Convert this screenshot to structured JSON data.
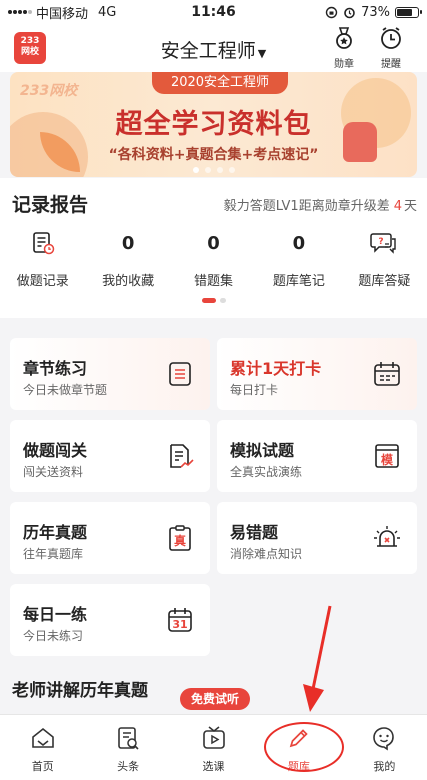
{
  "status": {
    "carrier": "中国移动",
    "network": "4G",
    "time": "11:46",
    "battery": "73%",
    "battery_level": 0.73
  },
  "header": {
    "logo_line1": "233",
    "logo_line2": "网校",
    "title": "安全工程师",
    "medal_label": "勋章",
    "remind_label": "提醒"
  },
  "banner": {
    "brand": "233网校",
    "pill": "2020安全工程师",
    "title": "超全学习资料包",
    "subtitle": "“各科资料+真题合集+考点速记”"
  },
  "record": {
    "title": "记录报告",
    "progress_prefix": "毅力答题LV1距离勋章升级差",
    "progress_num": "4",
    "progress_unit": "天",
    "items": [
      {
        "value": "",
        "icon": "record-doc-icon",
        "label": "做题记录"
      },
      {
        "value": "0",
        "label": "我的收藏"
      },
      {
        "value": "0",
        "label": "错题集"
      },
      {
        "value": "0",
        "label": "题库笔记"
      },
      {
        "value": "",
        "icon": "chat-question-icon",
        "label": "题库答疑"
      }
    ]
  },
  "cards": [
    {
      "title": "章节练习",
      "sub": "今日未做章节题",
      "icon": "list-doc-icon"
    },
    {
      "title": "累计1天打卡",
      "sub": "每日打卡",
      "icon": "calendar-check-icon",
      "accent": "#d9362b"
    },
    {
      "title": "做题闯关",
      "sub": "闯关送资料",
      "icon": "doc-chart-icon"
    },
    {
      "title": "模拟试题",
      "sub": "全真实战演练",
      "icon": "mock-paper-icon",
      "icon_text": "模"
    },
    {
      "title": "历年真题",
      "sub": "往年真题库",
      "icon": "clipboard-icon",
      "icon_text": "真"
    },
    {
      "title": "易错题",
      "sub": "消除难点知识",
      "icon": "alarm-icon"
    },
    {
      "title": "每日一练",
      "sub": "今日未练习",
      "icon": "calendar-31-icon",
      "icon_text": "31"
    }
  ],
  "section2": {
    "title": "老师讲解历年真题",
    "free_tag": "免费试听"
  },
  "tabs": [
    {
      "label": "首页",
      "icon": "home-icon"
    },
    {
      "label": "头条",
      "icon": "news-icon"
    },
    {
      "label": "选课",
      "icon": "video-course-icon"
    },
    {
      "label": "题库",
      "icon": "pencil-icon",
      "active": true
    },
    {
      "label": "我的",
      "icon": "profile-icon"
    }
  ],
  "colors": {
    "accent": "#e8453c",
    "annotation": "#e82e28"
  }
}
